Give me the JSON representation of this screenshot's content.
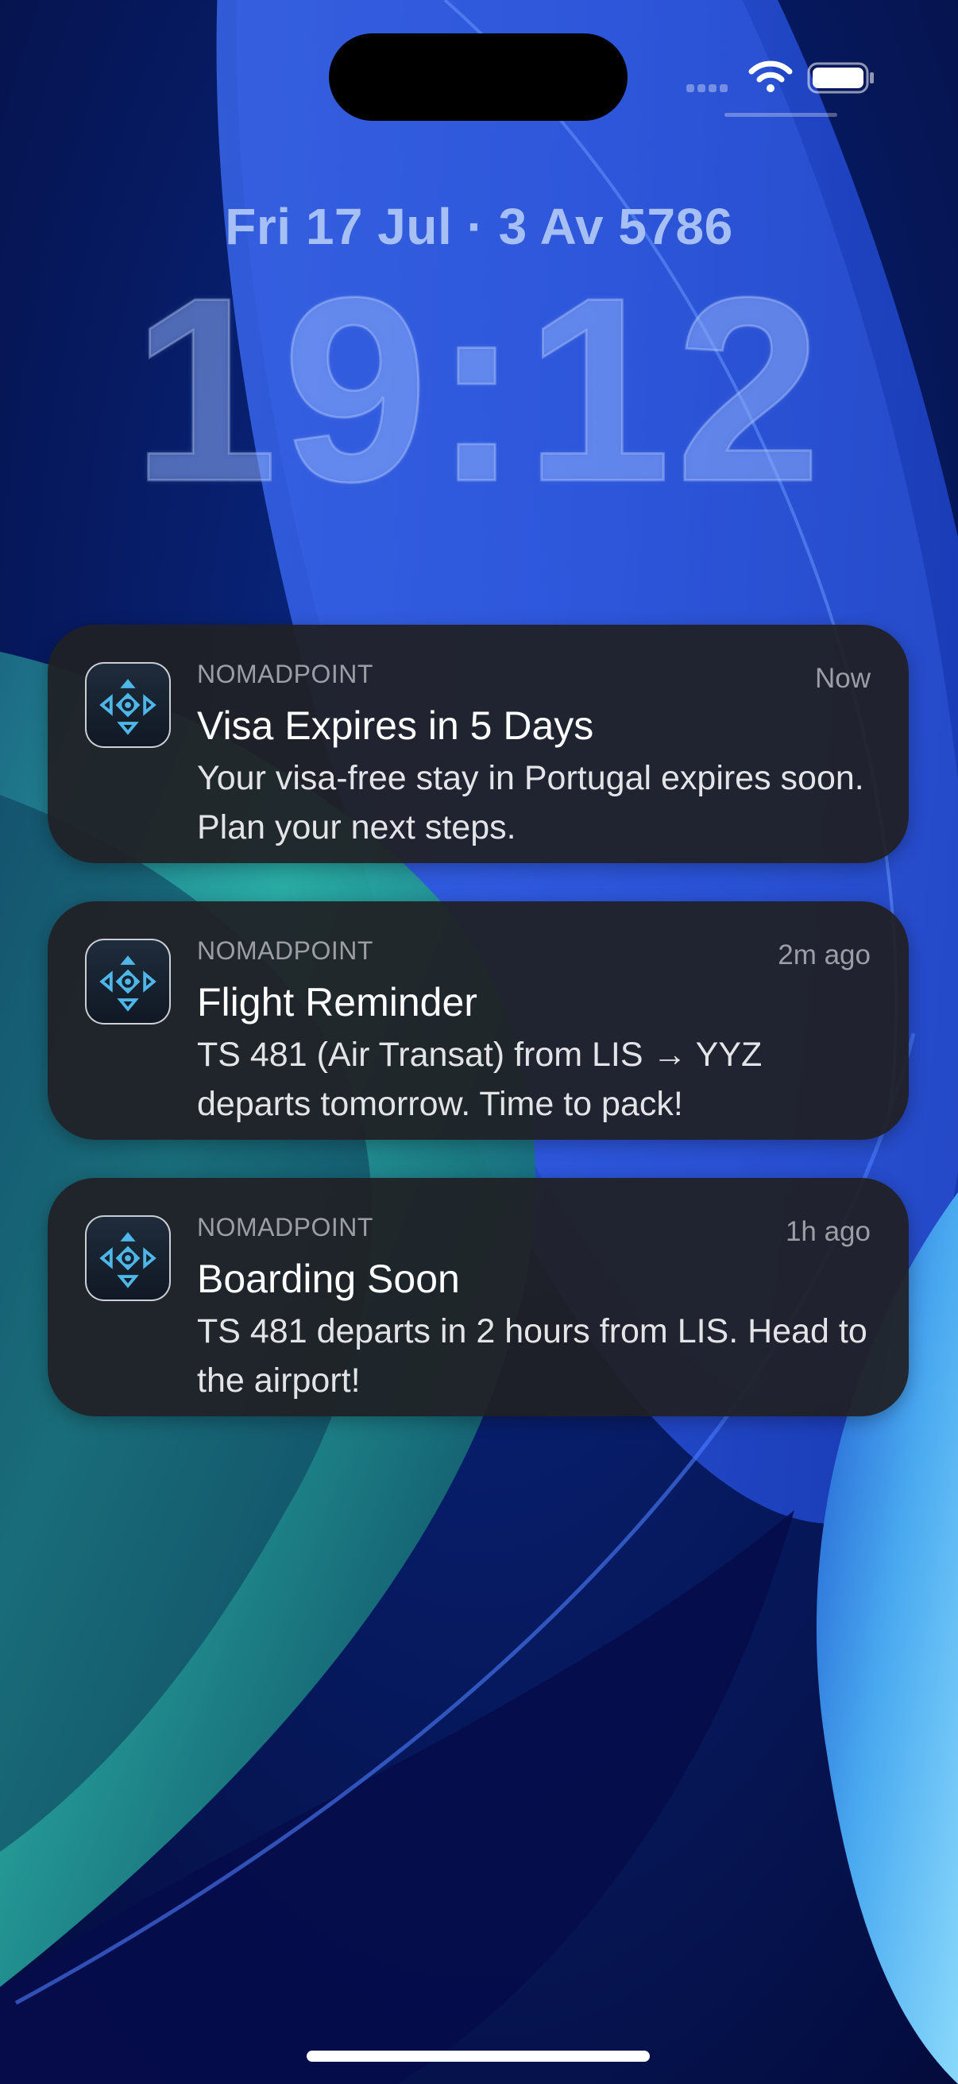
{
  "colors": {
    "wallpaper_base": "#040a3a",
    "wallpaper_blue": "#2b52d6",
    "wallpaper_teal": "#32b7a8",
    "wallpaper_light_blue": "#7fd3f6",
    "notification_background": "#202125",
    "date_text": "#a6bff4",
    "secondary_text": "#9c9ea5"
  },
  "status_bar": {
    "wifi_icon": "wifi-icon",
    "battery_icon": "battery-icon",
    "signal_icon": "signal-dots-icon"
  },
  "lock_screen": {
    "date": "Fri 17 Jul · 3 Av 5786",
    "time": "19:12"
  },
  "notifications": [
    {
      "app": "NOMADPOINT",
      "time": "Now",
      "title": "Visa Expires in 5 Days",
      "body": "Your visa-free stay in Portugal expires soon. Plan your next steps.",
      "icon": "nomadpoint-app-icon"
    },
    {
      "app": "NOMADPOINT",
      "time": "2m ago",
      "title": "Flight Reminder",
      "body": "TS 481 (Air Transat) from LIS → YYZ departs tomorrow. Time to pack!",
      "icon": "nomadpoint-app-icon"
    },
    {
      "app": "NOMADPOINT",
      "time": "1h ago",
      "title": "Boarding Soon",
      "body": "TS 481 departs in 2 hours from LIS. Head to the airport!",
      "icon": "nomadpoint-app-icon"
    }
  ]
}
